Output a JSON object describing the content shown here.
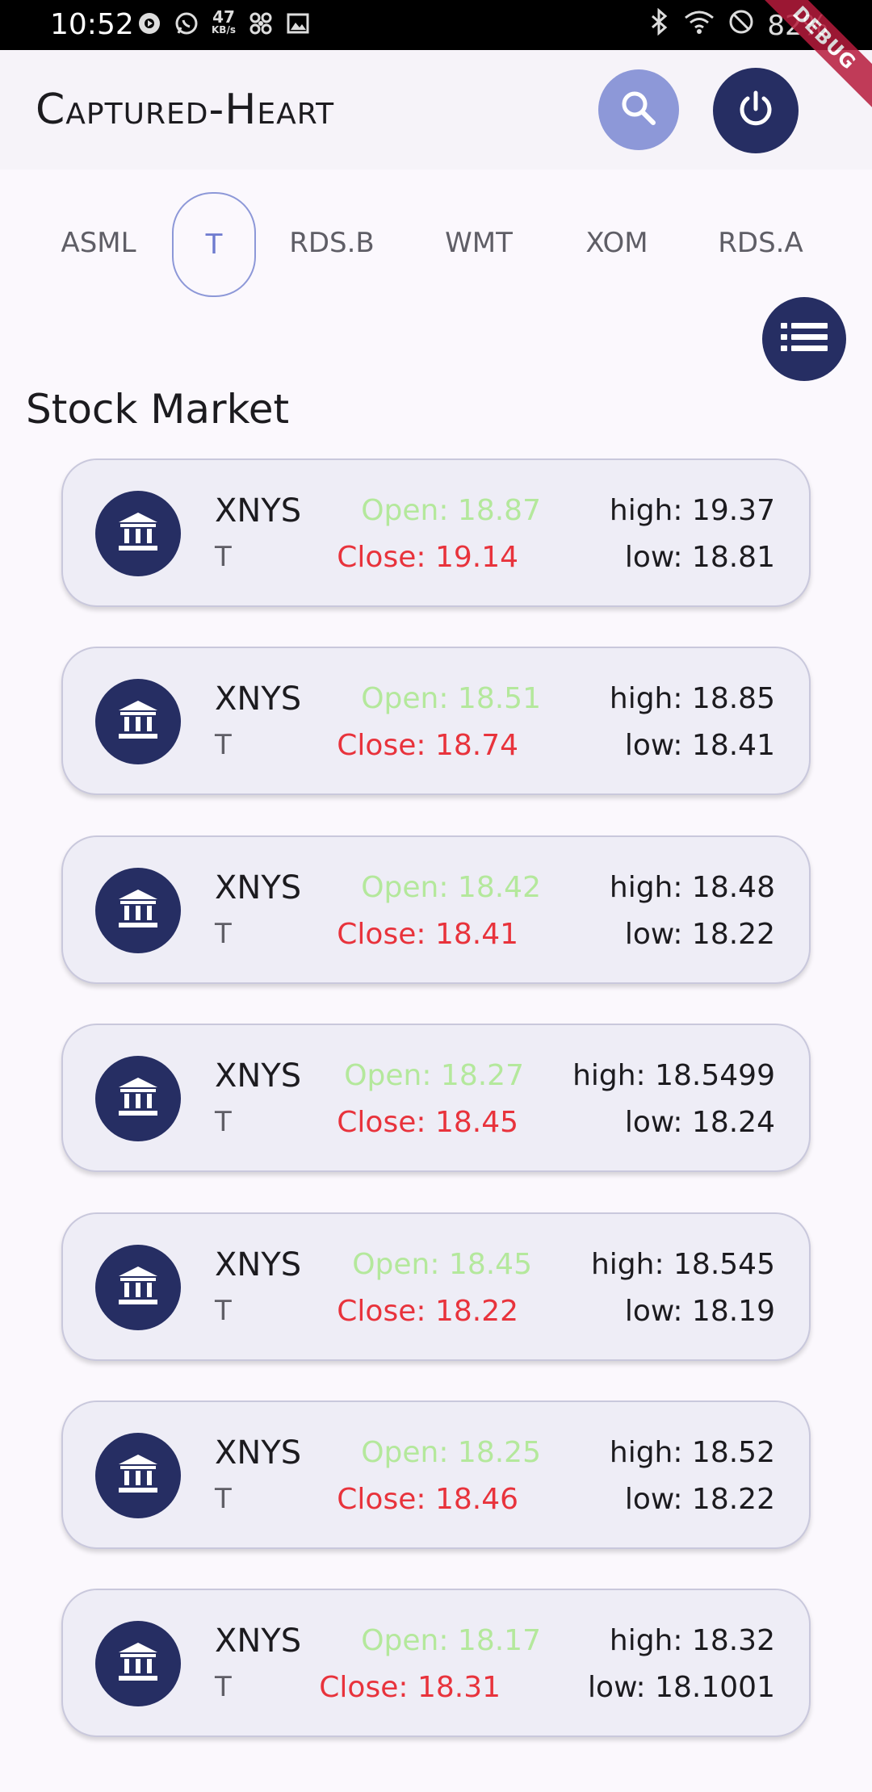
{
  "status_bar": {
    "time": "10:52",
    "net_speed_value": "47",
    "net_speed_unit": "KB/s",
    "battery": "82%"
  },
  "debug_banner": "DEBUG",
  "app_bar": {
    "title": "Captured-Heart"
  },
  "tabs": [
    "ASML",
    "T",
    "RDS.B",
    "WMT",
    "XOM",
    "RDS.A"
  ],
  "active_tab": "T",
  "section_title": "Stock Market",
  "stocks": [
    {
      "exchange": "XNYS",
      "symbol": "T",
      "open": "Open: 18.87",
      "close": "Close: 19.14",
      "high": "high: 19.37",
      "low": "low: 18.81"
    },
    {
      "exchange": "XNYS",
      "symbol": "T",
      "open": "Open: 18.51",
      "close": "Close: 18.74",
      "high": "high: 18.85",
      "low": "low: 18.41"
    },
    {
      "exchange": "XNYS",
      "symbol": "T",
      "open": "Open: 18.42",
      "close": "Close: 18.41",
      "high": "high: 18.48",
      "low": "low: 18.22"
    },
    {
      "exchange": "XNYS",
      "symbol": "T",
      "open": "Open: 18.27",
      "close": "Close: 18.45",
      "high": "high: 18.5499",
      "low": "low: 18.24"
    },
    {
      "exchange": "XNYS",
      "symbol": "T",
      "open": "Open: 18.45",
      "close": "Close: 18.22",
      "high": "high: 18.545",
      "low": "low: 18.19"
    },
    {
      "exchange": "XNYS",
      "symbol": "T",
      "open": "Open: 18.25",
      "close": "Close: 18.46",
      "high": "high: 18.52",
      "low": "low: 18.22"
    },
    {
      "exchange": "XNYS",
      "symbol": "T",
      "open": "Open: 18.17",
      "close": "Close: 18.31",
      "high": "high: 18.32",
      "low": "low: 18.1001"
    }
  ],
  "colors": {
    "primary_dark": "#262e63",
    "primary_light": "#8d98d8",
    "open_green": "#b4e89c",
    "close_red": "#e8333c",
    "card_bg": "#eeedf6"
  },
  "icons": {
    "search": "search-icon",
    "power": "power-icon",
    "list": "list-icon",
    "bank": "bank-icon"
  }
}
